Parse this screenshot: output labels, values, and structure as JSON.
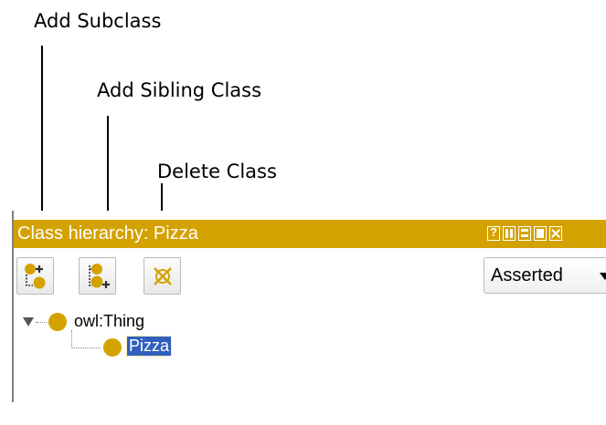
{
  "callouts": {
    "add_subclass": "Add Subclass",
    "add_sibling": "Add Sibling Class",
    "delete_class": "Delete Class"
  },
  "panel": {
    "title": "Class hierarchy: Pizza",
    "title_bg": "#d4a200",
    "window_buttons": [
      "help-icon",
      "split-columns-icon",
      "split-rows-icon",
      "maximize-icon",
      "close-icon"
    ],
    "toolbar": {
      "buttons": [
        "add-subclass-icon",
        "add-sibling-class-icon",
        "delete-class-icon"
      ],
      "mode_select": "Asserted"
    },
    "tree": {
      "root": {
        "label": "owl:Thing",
        "expanded": true,
        "icon": "class-dot-icon"
      },
      "children": [
        {
          "label": "Pizza",
          "selected": true,
          "icon": "class-dot-icon"
        }
      ]
    },
    "colors": {
      "class_icon": "#d4a200",
      "selection": "#2f5fbf"
    }
  }
}
